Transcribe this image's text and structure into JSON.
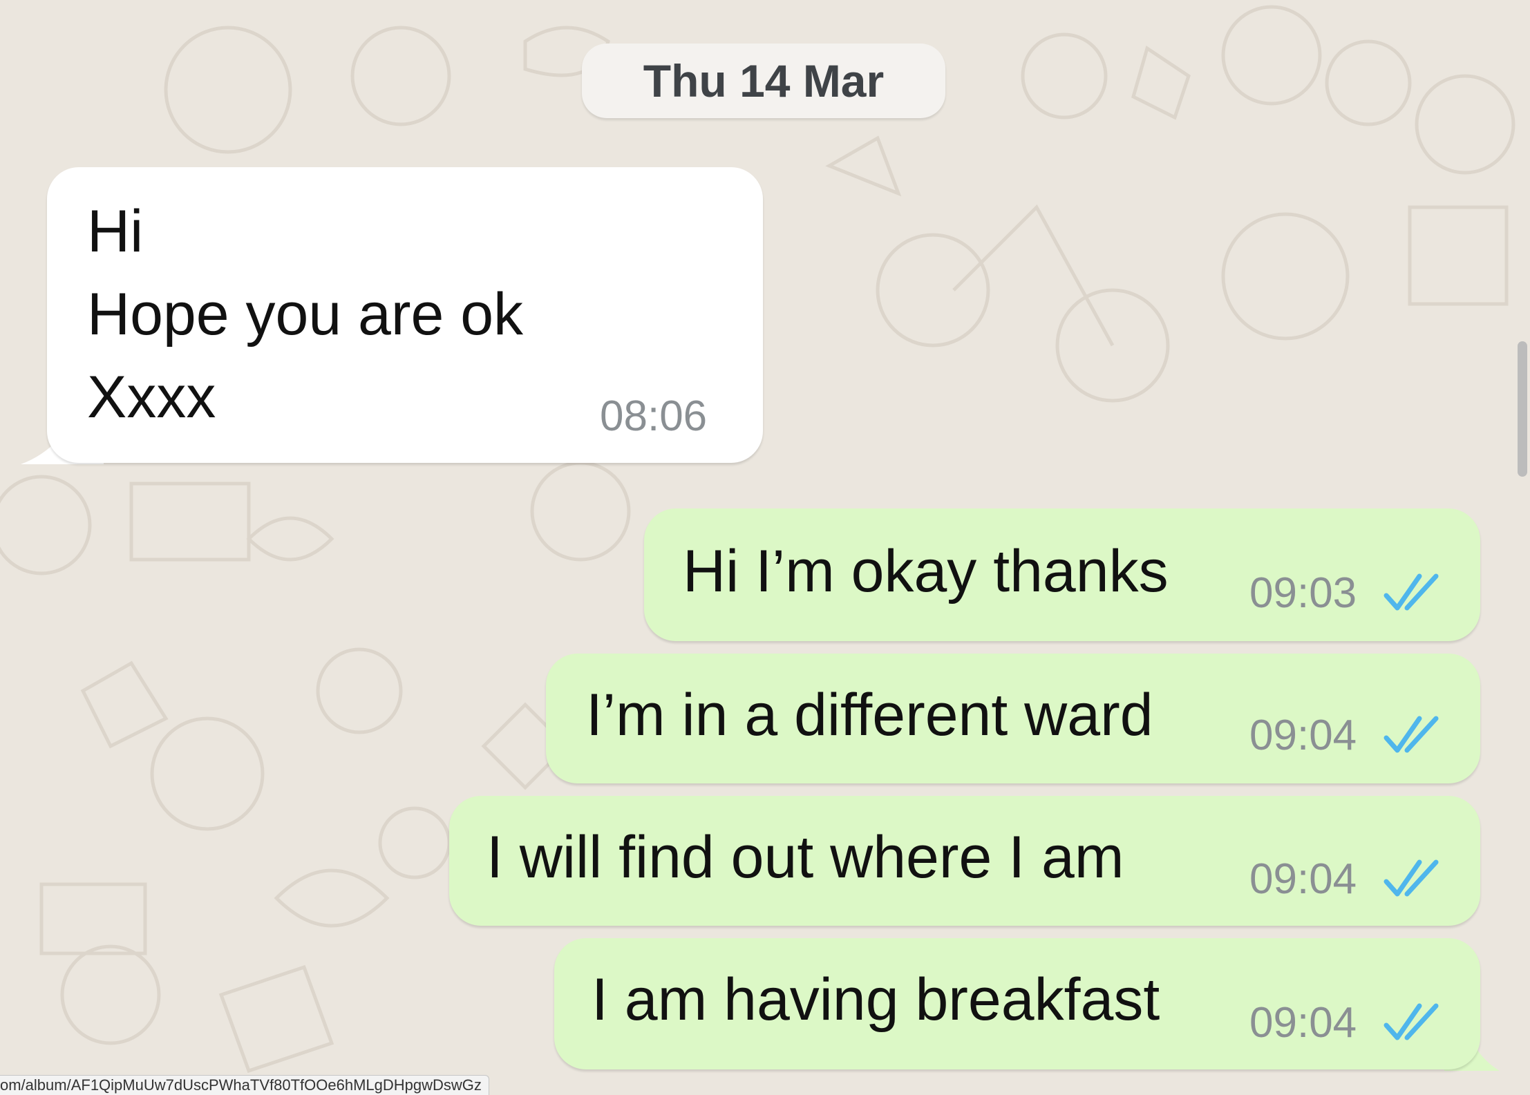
{
  "date_separator": "Thu 14 Mar",
  "incoming": {
    "lines": [
      "Hi",
      "Hope you are ok",
      "Xxxx"
    ],
    "time": "08:06"
  },
  "outgoing": [
    {
      "text": "Hi I’m okay thanks",
      "time": "09:03",
      "status": "read"
    },
    {
      "text": "I’m in a different ward",
      "time": "09:04",
      "status": "read"
    },
    {
      "text": "I will find out where I am",
      "time": "09:04",
      "status": "read"
    },
    {
      "text": "I am having breakfast",
      "time": "09:04",
      "status": "read"
    }
  ],
  "status_bar_url": "om/album/AF1QipMuUw7dUscPWhaTVf80TfOOe6hMLgDHpgwDswGz",
  "colors": {
    "background": "#ebe6de",
    "incoming_bubble": "#ffffff",
    "outgoing_bubble": "#dcf8c6",
    "read_ticks": "#4fb6ec",
    "timestamp": "#8a8f93"
  },
  "icons": {
    "read_receipt": "double-check-icon"
  }
}
